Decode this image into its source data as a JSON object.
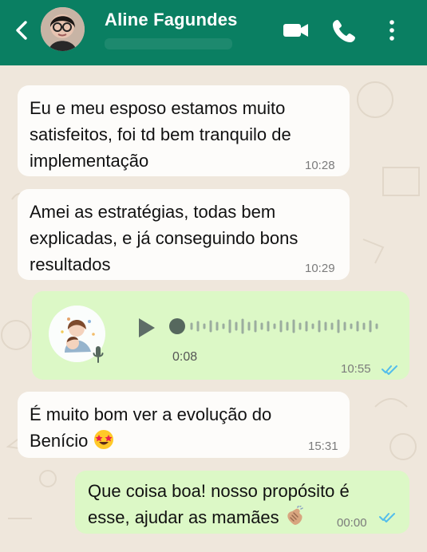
{
  "header": {
    "contact_name": "Aline Fagundes",
    "color": "#0a7f62"
  },
  "icons": {
    "back": "chevron-left-icon",
    "video": "video-camera-icon",
    "call": "phone-icon",
    "more": "more-vertical-icon"
  },
  "messages": [
    {
      "text_lines": [
        "Eu e meu esposo estamos muito",
        "satisfeitos, foi td bem tranquilo de",
        "implementação"
      ],
      "time": "10:28",
      "direction": "in"
    },
    {
      "text_lines": [
        "Amei as estratégias, todas bem",
        "explicadas, e já conseguindo bons",
        "resultados"
      ],
      "time": "10:29",
      "direction": "in"
    },
    {
      "type": "voice",
      "duration": "0:08",
      "time": "10:55",
      "direction": "out",
      "read": true
    },
    {
      "text_lines": [
        "É muito bom ver a evolução do",
        "Benício"
      ],
      "emoji": "star-struck-emoji",
      "time": "15:31",
      "direction": "in"
    },
    {
      "text_lines": [
        "Que coisa boa! nosso propósito é",
        "esse, ajudar as mamães"
      ],
      "emoji": "clapping-hands-emoji",
      "time": "00:00",
      "direction": "out",
      "read": true
    }
  ],
  "colors": {
    "incoming_bubble": "#fdfcfa",
    "outgoing_bubble": "#dcf8c6",
    "read_ticks": "#53bdeb"
  }
}
